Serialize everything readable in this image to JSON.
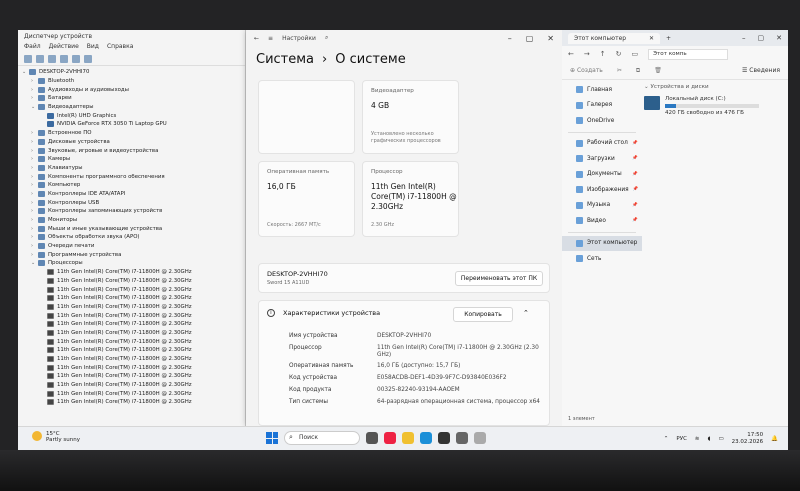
{
  "device_manager": {
    "title": "Диспетчер устройств",
    "menu": [
      "Файл",
      "Действие",
      "Вид",
      "Справка"
    ],
    "root": "DESKTOP-2VHHI70",
    "tree": [
      {
        "label": "Bluetooth",
        "level": 1,
        "expand": "›"
      },
      {
        "label": "Аудиовходы и аудиовыходы",
        "level": 1,
        "expand": "›"
      },
      {
        "label": "Батареи",
        "level": 1,
        "expand": "›"
      },
      {
        "label": "Видеоадаптеры",
        "level": 1,
        "expand": "⌄"
      },
      {
        "label": "Intel(R) UHD Graphics",
        "level": 2,
        "expand": ""
      },
      {
        "label": "NVIDIA GeForce RTX 3050 Ti Laptop GPU",
        "level": 2,
        "expand": ""
      },
      {
        "label": "Встроенное ПО",
        "level": 1,
        "expand": "›"
      },
      {
        "label": "Дисковые устройства",
        "level": 1,
        "expand": "›"
      },
      {
        "label": "Звуковые, игровые и видеоустройства",
        "level": 1,
        "expand": "›"
      },
      {
        "label": "Камеры",
        "level": 1,
        "expand": "›"
      },
      {
        "label": "Клавиатуры",
        "level": 1,
        "expand": "›"
      },
      {
        "label": "Компоненты программного обеспечения",
        "level": 1,
        "expand": "›"
      },
      {
        "label": "Компьютер",
        "level": 1,
        "expand": "›"
      },
      {
        "label": "Контроллеры IDE ATA/ATAPI",
        "level": 1,
        "expand": "›"
      },
      {
        "label": "Контроллеры USB",
        "level": 1,
        "expand": "›"
      },
      {
        "label": "Контроллеры запоминающих устройств",
        "level": 1,
        "expand": "›"
      },
      {
        "label": "Мониторы",
        "level": 1,
        "expand": "›"
      },
      {
        "label": "Мыши и иные указывающие устройства",
        "level": 1,
        "expand": "›"
      },
      {
        "label": "Объекты обработки звука (APO)",
        "level": 1,
        "expand": "›"
      },
      {
        "label": "Очереди печати",
        "level": 1,
        "expand": "›"
      },
      {
        "label": "Программные устройства",
        "level": 1,
        "expand": "›"
      },
      {
        "label": "Процессоры",
        "level": 1,
        "expand": "⌄"
      },
      {
        "label": "11th Gen Intel(R) Core(TM) i7-11800H @ 2.30GHz",
        "level": 2,
        "expand": ""
      },
      {
        "label": "11th Gen Intel(R) Core(TM) i7-11800H @ 2.30GHz",
        "level": 2,
        "expand": ""
      },
      {
        "label": "11th Gen Intel(R) Core(TM) i7-11800H @ 2.30GHz",
        "level": 2,
        "expand": ""
      },
      {
        "label": "11th Gen Intel(R) Core(TM) i7-11800H @ 2.30GHz",
        "level": 2,
        "expand": ""
      },
      {
        "label": "11th Gen Intel(R) Core(TM) i7-11800H @ 2.30GHz",
        "level": 2,
        "expand": ""
      },
      {
        "label": "11th Gen Intel(R) Core(TM) i7-11800H @ 2.30GHz",
        "level": 2,
        "expand": ""
      },
      {
        "label": "11th Gen Intel(R) Core(TM) i7-11800H @ 2.30GHz",
        "level": 2,
        "expand": ""
      },
      {
        "label": "11th Gen Intel(R) Core(TM) i7-11800H @ 2.30GHz",
        "level": 2,
        "expand": ""
      },
      {
        "label": "11th Gen Intel(R) Core(TM) i7-11800H @ 2.30GHz",
        "level": 2,
        "expand": ""
      },
      {
        "label": "11th Gen Intel(R) Core(TM) i7-11800H @ 2.30GHz",
        "level": 2,
        "expand": ""
      },
      {
        "label": "11th Gen Intel(R) Core(TM) i7-11800H @ 2.30GHz",
        "level": 2,
        "expand": ""
      },
      {
        "label": "11th Gen Intel(R) Core(TM) i7-11800H @ 2.30GHz",
        "level": 2,
        "expand": ""
      },
      {
        "label": "11th Gen Intel(R) Core(TM) i7-11800H @ 2.30GHz",
        "level": 2,
        "expand": ""
      },
      {
        "label": "11th Gen Intel(R) Core(TM) i7-11800H @ 2.30GHz",
        "level": 2,
        "expand": ""
      },
      {
        "label": "11th Gen Intel(R) Core(TM) i7-11800H @ 2.30GHz",
        "level": 2,
        "expand": ""
      },
      {
        "label": "11th Gen Intel(R) Core(TM) i7-11800H @ 2.30GHz",
        "level": 2,
        "expand": ""
      }
    ]
  },
  "settings": {
    "app_title": "Настройки",
    "breadcrumb_parent": "Система",
    "breadcrumb_sep": "›",
    "page_title": "О системе",
    "cards": {
      "video_label": "Видеоадаптер",
      "video_value": "4 GB",
      "video_sub": "Установлено несколько графических процессоров",
      "ram_label": "Оперативная память",
      "ram_value": "16,0 ГБ",
      "ram_sub": "Скорость: 2667 МТ/с",
      "cpu_label": "Процессор",
      "cpu_value": "11th Gen Intel(R) Core(TM) i7-11800H @ 2.30GHz",
      "cpu_sub": "2.30 GHz"
    },
    "device_name": "DESKTOP-2VHHI70",
    "device_model": "Sword 15 A11UD",
    "rename_button": "Переименовать этот ПК",
    "specs_title": "Характеристики устройства",
    "copy_button": "Копировать",
    "specs": [
      {
        "key": "Имя устройства",
        "value": "DESKTOP-2VHHI70"
      },
      {
        "key": "Процессор",
        "value": "11th Gen Intel(R) Core(TM) i7-11800H @ 2.30GHz (2.30 GHz)"
      },
      {
        "key": "Оперативная память",
        "value": "16,0 ГБ (доступно: 15,7 ГБ)"
      },
      {
        "key": "Код устройства",
        "value": "E058ACDB-DEF1-4D39-9F7C-D93840E036F2"
      },
      {
        "key": "Код продукта",
        "value": "00325-82240-93194-AAOEM"
      },
      {
        "key": "Тип системы",
        "value": "64-разрядная операционная система, процессор x64"
      }
    ]
  },
  "explorer": {
    "tab_title": "Этот компьютер",
    "address": "Этот компь",
    "create": "Создать",
    "view": "Сведения",
    "sidebar": [
      "Главная",
      "Галерея",
      "OneDrive"
    ],
    "pinned": [
      "Рабочий стол",
      "Загрузки",
      "Документы",
      "Изображения",
      "Музыка",
      "Видео"
    ],
    "this_pc": "Этот компьютер",
    "network": "Сеть",
    "group": "Устройства и диски",
    "drive_name": "Локальный диск (C:)",
    "drive_free": "420 ГБ свободно из 476 ГБ",
    "drive_used_fraction": 0.12,
    "status": "1 элемент"
  },
  "taskbar": {
    "temp": "15°C",
    "weather": "Partly sunny",
    "search": "Поиск",
    "lang": "РУС",
    "time": "17:50",
    "date": "23.02.2026"
  }
}
